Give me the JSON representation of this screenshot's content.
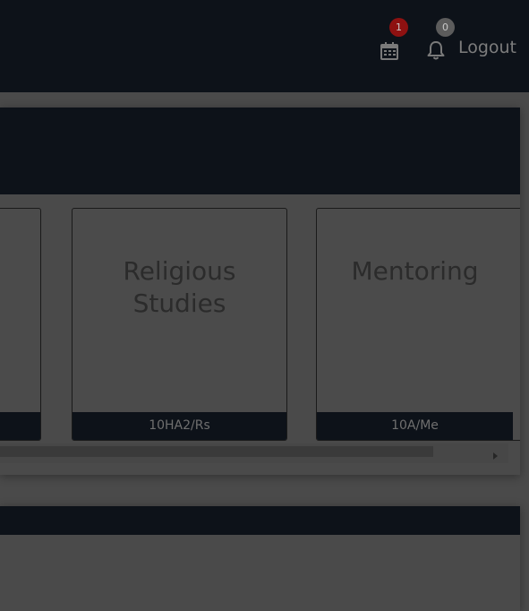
{
  "header": {
    "calendar_badge": "1",
    "notifications_badge": "0",
    "logout_label": "Logout"
  },
  "cards": [
    {
      "title": "",
      "code": ""
    },
    {
      "title": "Religious Studies",
      "code": "10HA2/Rs"
    },
    {
      "title": "Mentoring",
      "code": "10A/Me"
    }
  ],
  "colors": {
    "navbar": "#0d1219",
    "badge_red": "#8e1111",
    "badge_grey": "#5c5c5c",
    "overlay_bg": "#4a4a4a"
  },
  "icons": {
    "calendar": "calendar-icon",
    "bell": "bell-icon",
    "scroll_right": "chevron-right-icon"
  }
}
